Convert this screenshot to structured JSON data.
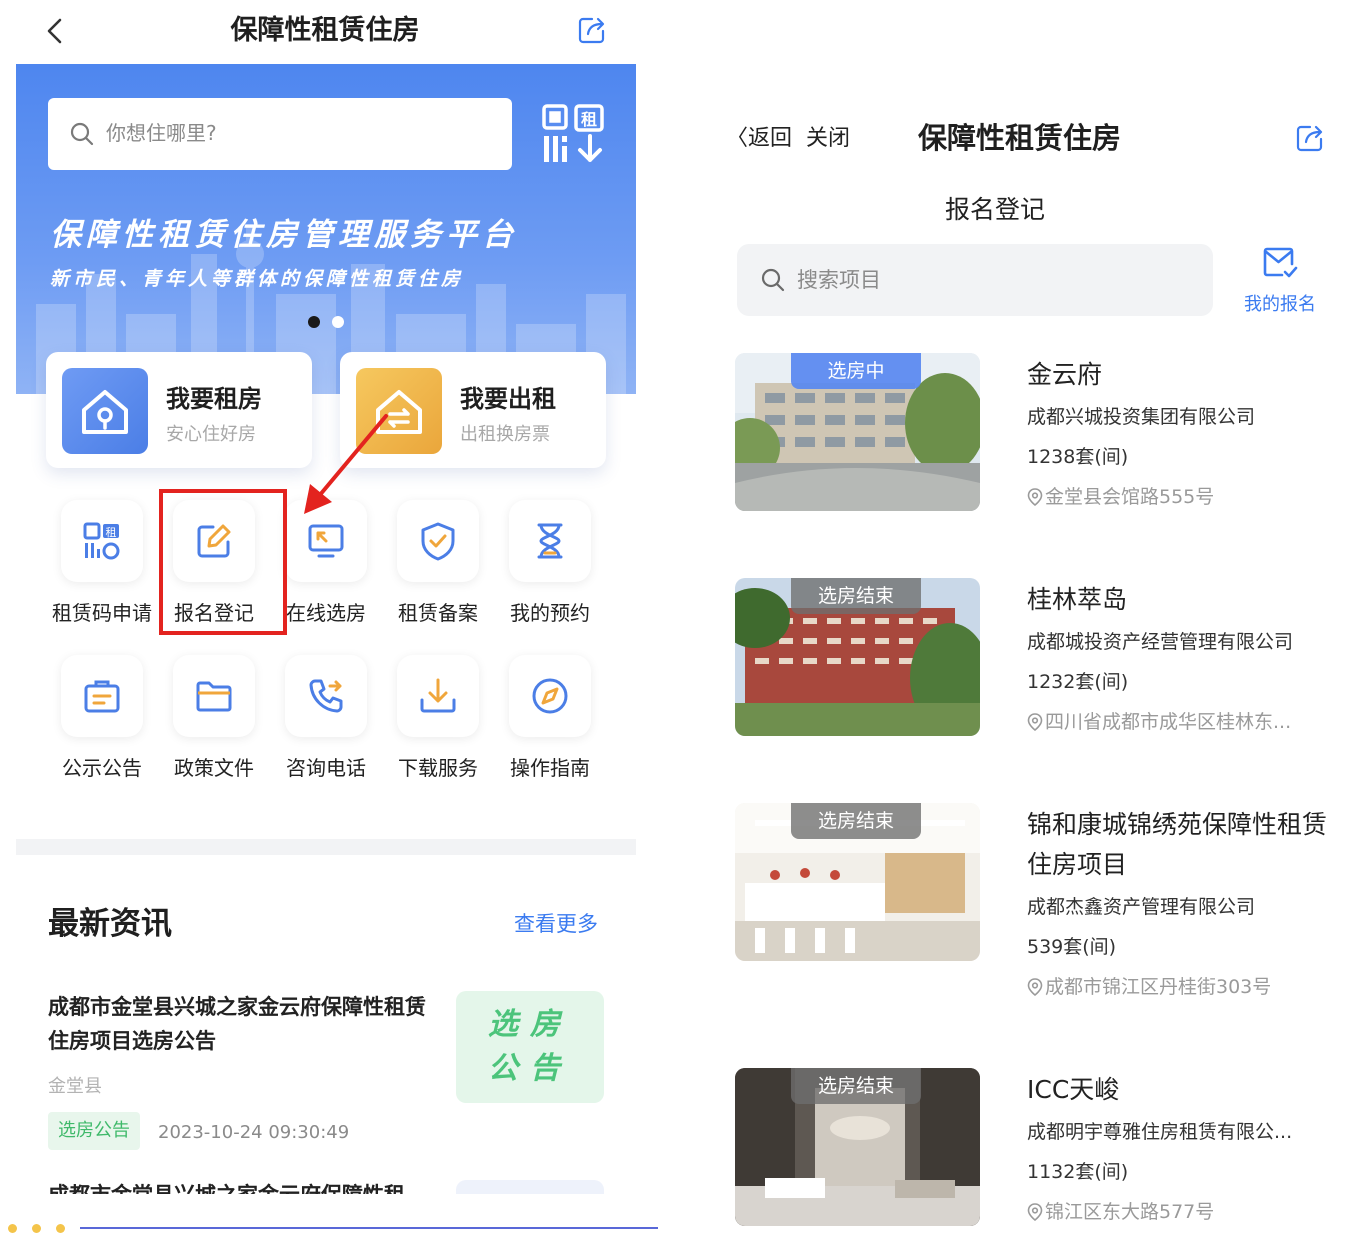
{
  "left": {
    "header": {
      "title": "保障性租赁住房",
      "back_icon": "chevron-left-icon",
      "share_icon": "share-icon"
    },
    "banner": {
      "search_placeholder": "你想住哪里?",
      "qr_icon": "qr-rent-scan-icon",
      "title": "保障性租赁住房管理服务平台",
      "subtitle": "新市民、青年人等群体的保障性租赁住房",
      "carousel_active_index": 0,
      "carousel_count": 2
    },
    "cards": [
      {
        "title": "我要租房",
        "subtitle": "安心住好房",
        "icon": "house-key-icon",
        "color": "#4b7ee6"
      },
      {
        "title": "我要出租",
        "subtitle": "出租换房票",
        "icon": "house-lease-icon",
        "color": "#eaa63b"
      }
    ],
    "services": [
      {
        "label": "租赁码申请",
        "icon": "rent-code-icon"
      },
      {
        "label": "报名登记",
        "icon": "edit-form-icon"
      },
      {
        "label": "在线选房",
        "icon": "online-select-icon"
      },
      {
        "label": "租赁备案",
        "icon": "shield-check-icon"
      },
      {
        "label": "我的预约",
        "icon": "hourglass-icon"
      },
      {
        "label": "公示公告",
        "icon": "briefcase-icon"
      },
      {
        "label": "政策文件",
        "icon": "folder-icon"
      },
      {
        "label": "咨询电话",
        "icon": "phone-call-icon"
      },
      {
        "label": "下载服务",
        "icon": "download-icon"
      },
      {
        "label": "操作指南",
        "icon": "compass-icon"
      }
    ],
    "news": {
      "title": "最新资讯",
      "more": "查看更多",
      "items": [
        {
          "title": "成都市金堂县兴城之家金云府保障性租赁住房项目选房公告",
          "location": "金堂县",
          "tag": "选房公告",
          "time": "2023-10-24 09:30:49",
          "thumb_line1": "选房",
          "thumb_line2": "公告"
        },
        {
          "title": "成都市金堂县兴城之家金云府保障性租"
        }
      ]
    },
    "accent_color": "#3b7bf0",
    "highlight_color": "#e3231f"
  },
  "right": {
    "header": {
      "back": "〈返回",
      "close": "关闭",
      "title": "保障性租赁住房",
      "share_icon": "share-icon"
    },
    "subtitle": "报名登记",
    "search_placeholder": "搜索项目",
    "my_signup": {
      "label": "我的报名",
      "icon": "mail-check-icon"
    },
    "projects": [
      {
        "status": "选房中",
        "name": "金云府",
        "org": "成都兴城投资集团有限公司",
        "count": "1238套(间)",
        "address": "金堂县会馆路555号"
      },
      {
        "status": "选房结束",
        "name": "桂林萃岛",
        "org": "成都城投资产经营管理有限公司",
        "count": "1232套(间)",
        "address": "四川省成都市成华区桂林东..."
      },
      {
        "status": "选房结束",
        "name": "锦和康城锦绣苑保障性租赁住房项目",
        "org": "成都杰鑫资产管理有限公司",
        "count": "539套(间)",
        "address": "成都市锦江区丹桂街303号"
      },
      {
        "status": "选房结束",
        "name": "ICC天峻",
        "org": "成都明宇尊雅住房租赁有限公...",
        "count": "1132套(间)",
        "address": "锦江区东大路577号"
      }
    ]
  }
}
